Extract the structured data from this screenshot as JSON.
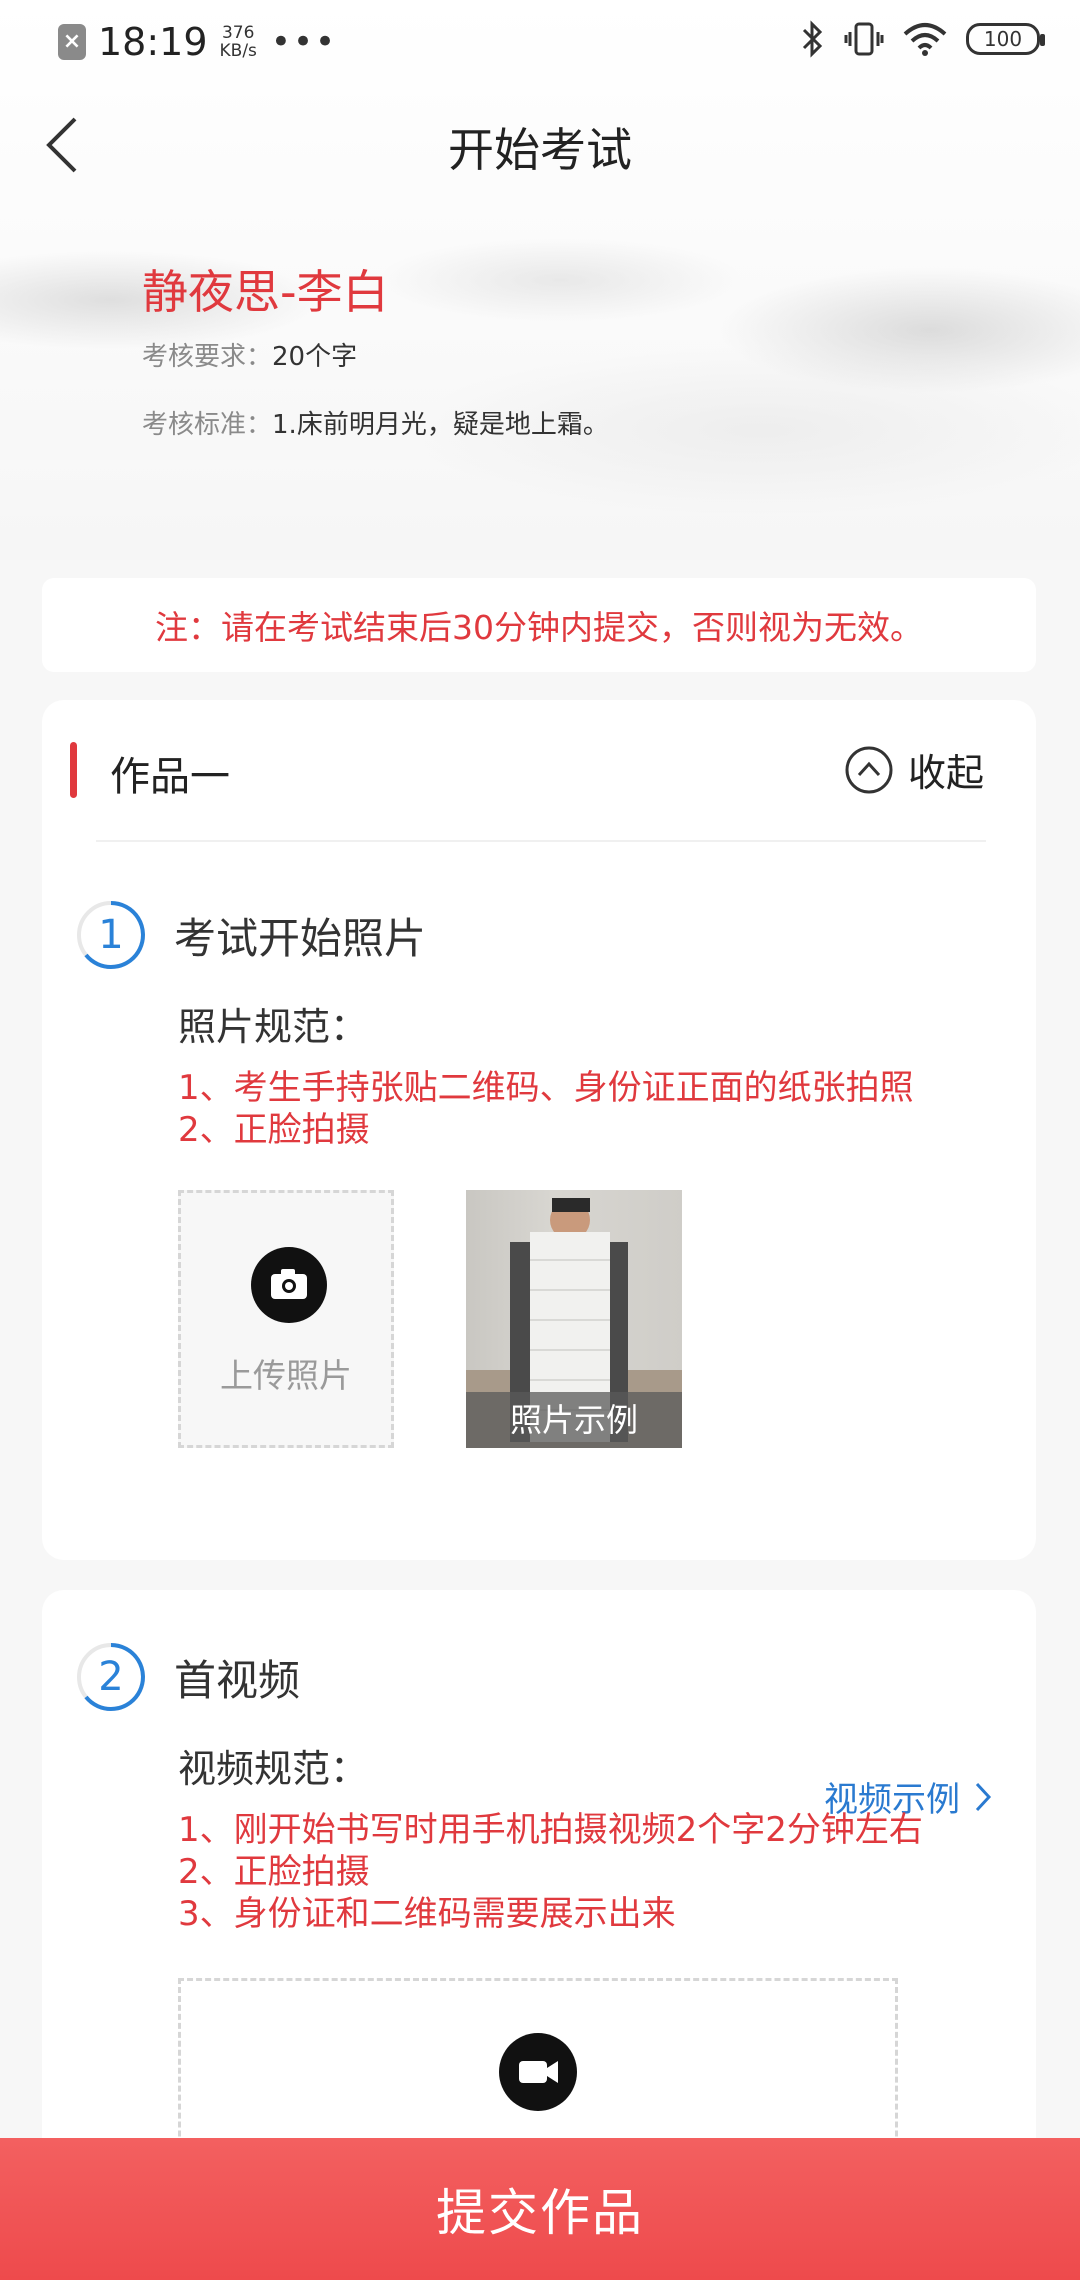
{
  "status_bar": {
    "time": "18:19",
    "speed_value": "376",
    "speed_unit": "KB/s",
    "more": "•••",
    "battery": "100"
  },
  "nav": {
    "title": "开始考试"
  },
  "exam": {
    "title": "静夜思-李白",
    "requirement_label": "考核要求：",
    "requirement_value": "20个字",
    "standard_label": "考核标准：",
    "standard_value": "1.床前明月光，疑是地上霜。"
  },
  "notice": "注：请在考试结束后30分钟内提交，否则视为无效。",
  "work": {
    "title": "作品一",
    "collapse_label": "收起"
  },
  "step1": {
    "number": "1",
    "title": "考试开始照片",
    "spec_label": "照片规范：",
    "rules": [
      "1、考生手持张贴二维码、身份证正面的纸张拍照",
      "2、正脸拍摄"
    ],
    "upload_label": "上传照片",
    "example_caption": "照片示例"
  },
  "step2": {
    "number": "2",
    "title": "首视频",
    "spec_label": "视频规范：",
    "example_link": "视频示例",
    "rules": [
      "1、刚开始书写时用手机拍摄视频2个字2分钟左右",
      "2、正脸拍摄",
      "3、身份证和二维码需要展示出来"
    ]
  },
  "submit_label": "提交作品",
  "colors": {
    "accent_red": "#e0393e",
    "link_blue": "#2a7ad0",
    "submit_bg": "#ee4a4c"
  }
}
